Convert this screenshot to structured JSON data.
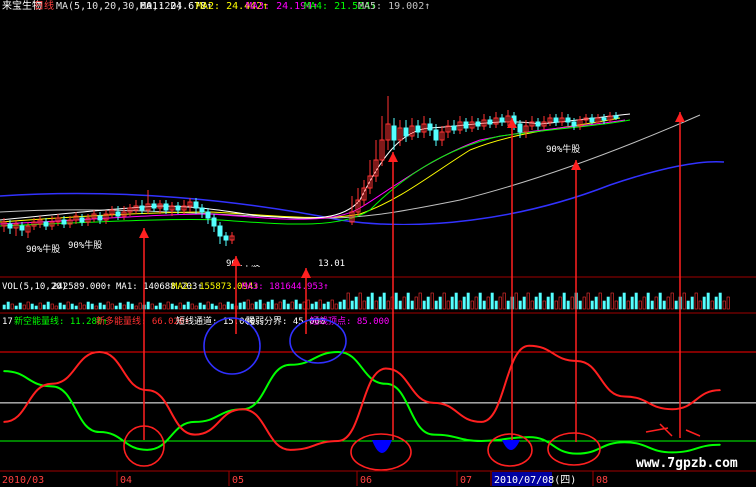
{
  "header": {
    "stock_name": "来宝生物",
    "period": "日线",
    "ma_label": "MA(5,10,20,30,60,120)",
    "ma_values": [
      {
        "label": "MA1: 24.678↑",
        "color": "#ffffff"
      },
      {
        "label": "MA2: 24.442↑",
        "color": "#ffff00"
      },
      {
        "label": "MA3: 24.194↑",
        "color": "#ff00ff"
      },
      {
        "label": "MA4: 21.524↑",
        "color": "#00ff00"
      },
      {
        "label": "MA5: 19.002↑",
        "color": "#c0c0c0"
      }
    ]
  },
  "annotations": {
    "bull_label": "90%牛股",
    "price_fragment": "13.01",
    "watermark": "www.7gpzb.com"
  },
  "volume_panel": {
    "label": "VOL(5,10,20)",
    "vol": "242589.000↑",
    "ma1": "MA1: 140688.203↑",
    "ma2": "MA2: 155873.094↑",
    "ma3": "MA3: 181644.953↑"
  },
  "indicator_panel": {
    "index": "17",
    "name": "新空能量线: 11.280↑",
    "long_line": "新多能量线: 66.026↑",
    "short_channel": "短线通道: 15.000",
    "strength": "强弱分界: 45.000",
    "short_top": "短线顶点: 85.000"
  },
  "x_axis": {
    "labels": [
      "2010/03",
      "04",
      "05",
      "06",
      "07",
      "2010/07/08(四)",
      "08"
    ]
  },
  "colors": {
    "up": "#ff3232",
    "down": "#54ffff",
    "ma1": "#ffffff",
    "ma2": "#ffff00",
    "ma3": "#ff00ff",
    "ma4": "#00ff00",
    "ma5": "#c0c0c0",
    "ma6": "#3232ff",
    "energy_green": "#00ff00",
    "energy_red": "#ff2020",
    "highlight": "#0000ff"
  },
  "chart_data": {
    "type": "line",
    "x": [
      "2010/03",
      "04",
      "05",
      "06",
      "07",
      "08"
    ],
    "series": [
      {
        "name": "新空能量线",
        "values": [
          70,
          58,
          22,
          8,
          30,
          40,
          75,
          85,
          60,
          20,
          15,
          18,
          5,
          14,
          6,
          12
        ]
      },
      {
        "name": "新多能量线",
        "values": [
          30,
          60,
          85,
          55,
          20,
          40,
          8,
          15,
          72,
          45,
          30,
          90,
          78,
          50,
          40,
          55
        ]
      }
    ],
    "levels": [
      15,
      45,
      85
    ],
    "ylim": [
      0,
      100
    ]
  }
}
